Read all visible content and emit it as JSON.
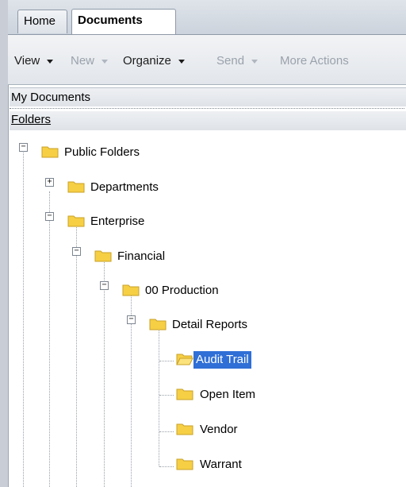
{
  "tabs": [
    {
      "label": "Home"
    },
    {
      "label": "Documents"
    }
  ],
  "toolbar": {
    "view": "View",
    "new": "New",
    "organize": "Organize",
    "send": "Send",
    "more_actions": "More Actions"
  },
  "panel": {
    "my_documents": "My Documents",
    "folders": "Folders"
  },
  "tree": {
    "public_folders": "Public Folders",
    "departments": "Departments",
    "enterprise": "Enterprise",
    "financial": "Financial",
    "production": "00 Production",
    "detail_reports": "Detail Reports",
    "audit_trail": "Audit Trail",
    "open_item": "Open Item",
    "vendor": "Vendor",
    "warrant": "Warrant"
  },
  "colors": {
    "selection": "#2f6fd6",
    "folder_yellow": "#f6cf44"
  }
}
